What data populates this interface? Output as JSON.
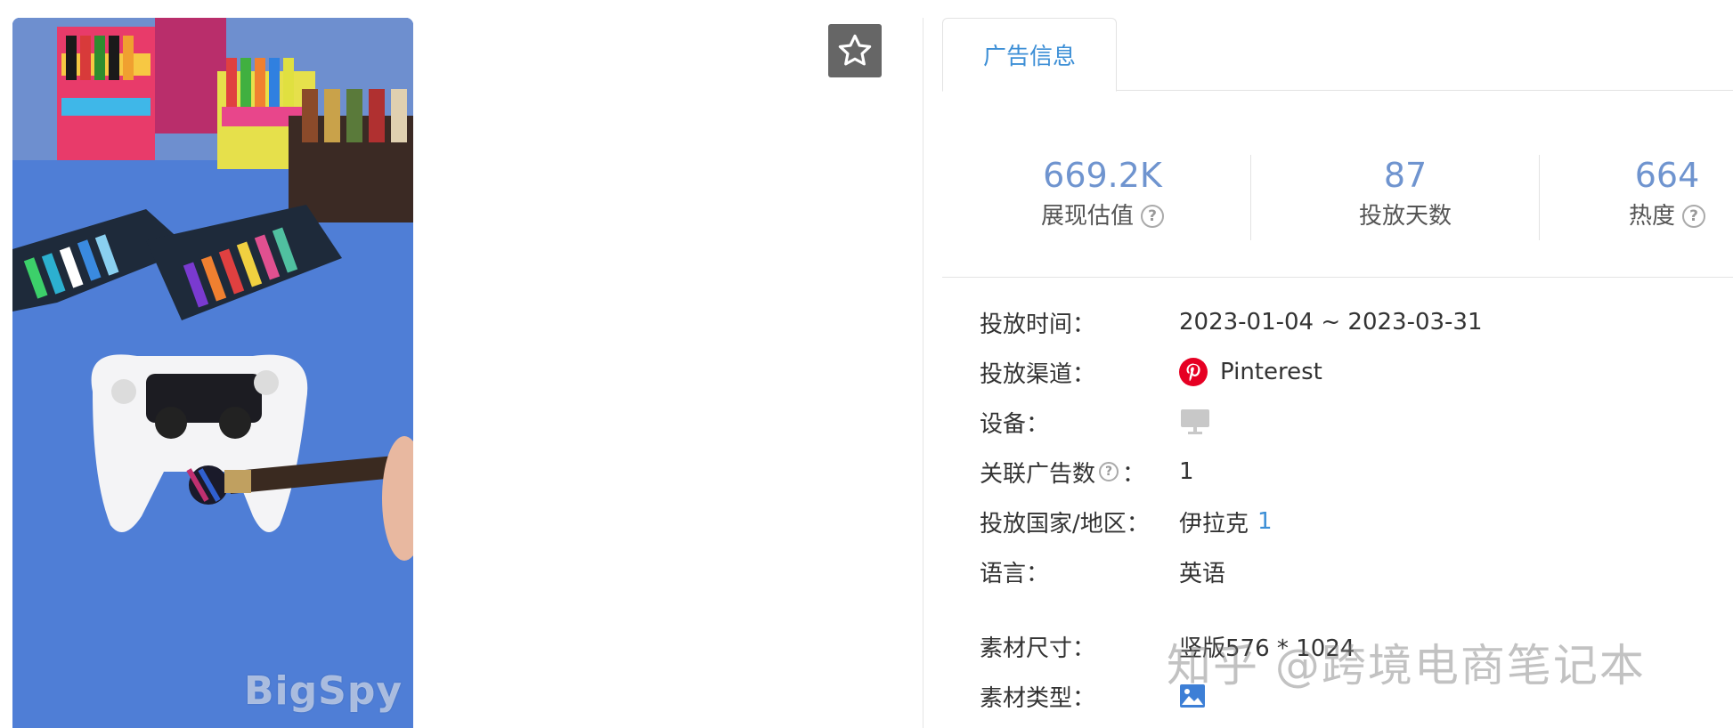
{
  "media": {
    "watermark": "BigSpy"
  },
  "favorite": {
    "icon": "star-outline-icon"
  },
  "tabs": [
    {
      "label": "广告信息"
    }
  ],
  "stats": [
    {
      "value": "669.2K",
      "label": "展现估值",
      "help": true
    },
    {
      "value": "87",
      "label": "投放天数",
      "help": false
    },
    {
      "value": "664",
      "label": "热度",
      "help": true
    }
  ],
  "details": {
    "time": {
      "label": "投放时间：",
      "value": "2023-01-04 ~ 2023-03-31"
    },
    "channel": {
      "label": "投放渠道：",
      "value": "Pinterest",
      "icon": "pinterest-icon",
      "icon_color": "#e60023"
    },
    "device": {
      "label": "设备：",
      "icon": "desktop-icon"
    },
    "related": {
      "label": "关联广告数",
      "colon": "：",
      "value": "1"
    },
    "region": {
      "label": "投放国家/地区：",
      "value": "伊拉克",
      "count": "1"
    },
    "language": {
      "label": "语言：",
      "value": "英语"
    },
    "size": {
      "label": "素材尺寸：",
      "value": "竖版576 * 1024"
    },
    "type": {
      "label": "素材类型：",
      "icon": "image-icon"
    }
  },
  "overlay_watermark": "知乎 @跨境电商笔记本",
  "colors": {
    "accent": "#3d8fd6",
    "stat_value": "#6f94cf",
    "fav_bg": "#666666"
  }
}
